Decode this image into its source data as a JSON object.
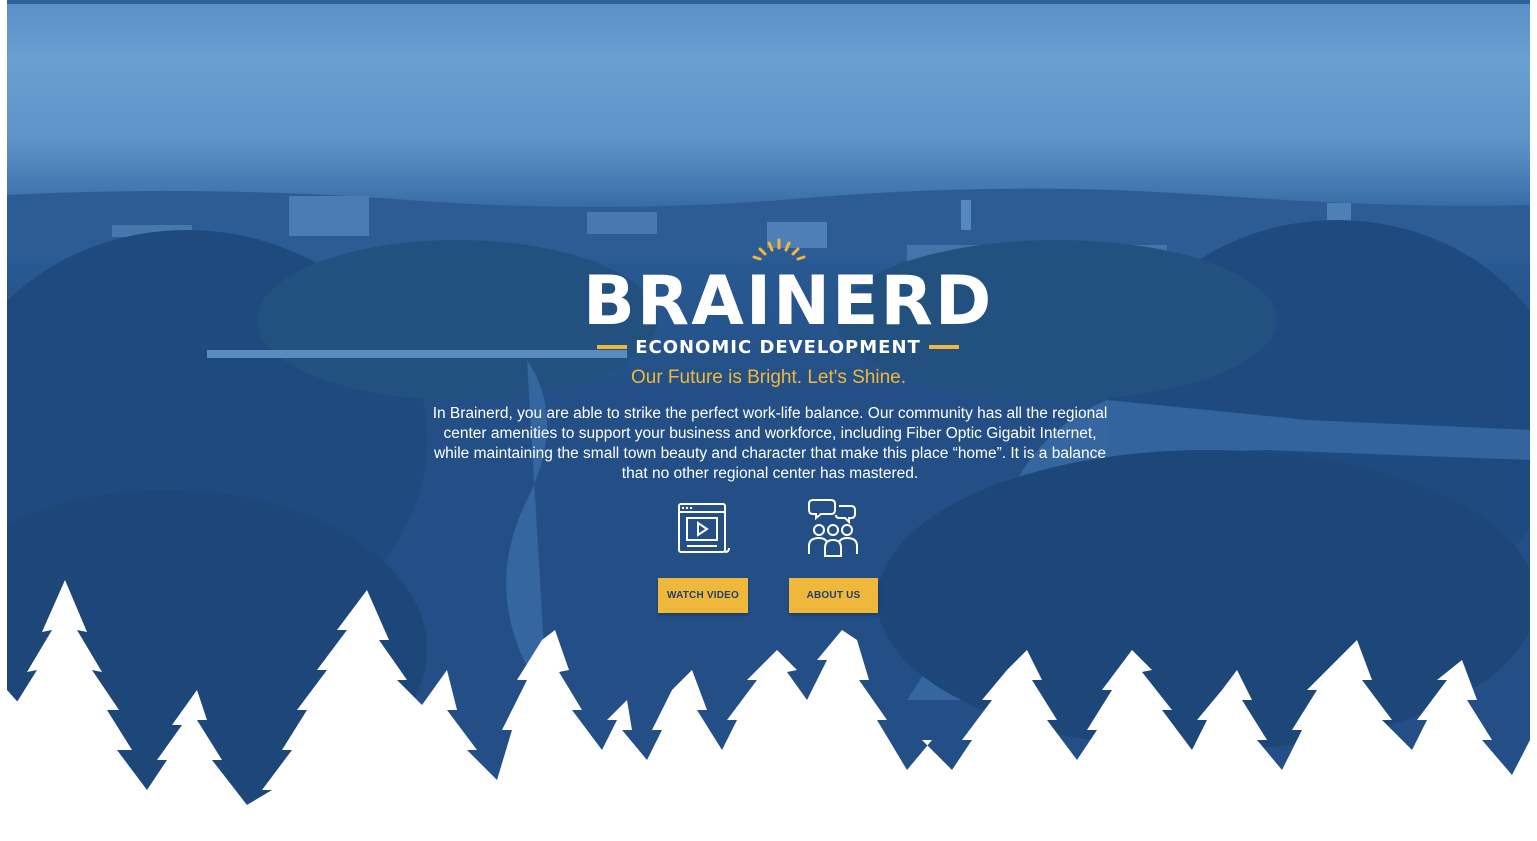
{
  "brand": {
    "name": "BRAINERD",
    "subtitle": "ECONOMIC DEVELOPMENT"
  },
  "hero": {
    "tagline": "Our Future is Bright. Let's Shine.",
    "description": "In Brainerd, you are able to strike the perfect work-life balance. Our community has all the regional center amenities to support your business and workforce, including Fiber Optic Gigabit Internet, while maintaining the small town beauty and character that make this place “home”. It is a balance that no other regional center has mastered."
  },
  "actions": {
    "watch_video_label": "WATCH VIDEO",
    "about_us_label": "ABOUT US",
    "watch_video_icon": "video-player-icon",
    "about_us_icon": "community-group-icon"
  },
  "colors": {
    "accent": "#f0b83a",
    "overlay_blue": "#244f86",
    "sky": "#6a9fd2",
    "text": "#ffffff"
  }
}
